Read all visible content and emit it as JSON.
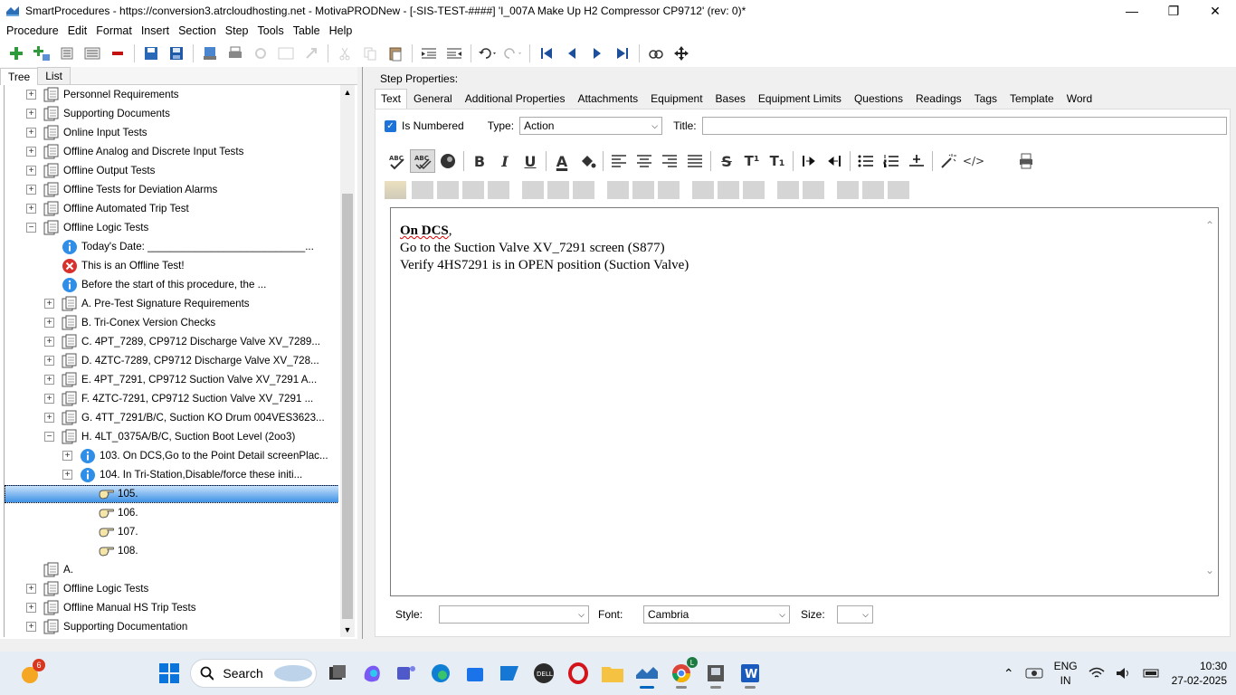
{
  "window": {
    "title": "SmartProcedures - https://conversion3.atrcloudhosting.net - MotivaPRODNew - [-SIS-TEST-####] 'I_007A Make Up H2 Compressor CP9712' (rev: 0)*",
    "controls": [
      "minimize-icon",
      "maximize-icon",
      "close-icon"
    ]
  },
  "menu": [
    "Procedure",
    "Edit",
    "Format",
    "Insert",
    "Section",
    "Step",
    "Tools",
    "Table",
    "Help"
  ],
  "left_tabs": [
    "Tree",
    "List"
  ],
  "tree": [
    {
      "label": "Personnel Requirements",
      "expander": "+",
      "icon": "page-stack-icon"
    },
    {
      "label": "Supporting Documents",
      "expander": "+",
      "icon": "page-stack-icon"
    },
    {
      "label": "Online Input Tests",
      "expander": "+",
      "icon": "page-stack-icon"
    },
    {
      "label": "Offline Analog and Discrete Input Tests",
      "expander": "+",
      "icon": "page-stack-icon"
    },
    {
      "label": "Offline Output Tests",
      "expander": "+",
      "icon": "page-stack-icon"
    },
    {
      "label": "Offline Tests for Deviation Alarms",
      "expander": "+",
      "icon": "page-stack-icon"
    },
    {
      "label": "Offline Automated Trip Test",
      "expander": "+",
      "icon": "page-stack-icon"
    },
    {
      "label": "Offline Logic Tests",
      "expander": "−",
      "icon": "page-stack-icon"
    },
    {
      "label": "Today's Date: ___________________________...",
      "expander": "",
      "icon": "info-icon"
    },
    {
      "label": "This is an Offline Test!",
      "expander": "",
      "icon": "error-icon"
    },
    {
      "label": "Before the start of this procedure, the ...",
      "expander": "",
      "icon": "info-icon"
    },
    {
      "label": "A. Pre-Test Signature Requirements",
      "expander": "+",
      "icon": "page-stack-icon"
    },
    {
      "label": "B. Tri-Conex Version Checks",
      "expander": "+",
      "icon": "page-stack-icon"
    },
    {
      "label": "C. 4PT_7289, CP9712 Discharge Valve XV_7289...",
      "expander": "+",
      "icon": "page-stack-icon"
    },
    {
      "label": "D. 4ZTC-7289, CP9712 Discharge Valve XV_728...",
      "expander": "+",
      "icon": "page-stack-icon"
    },
    {
      "label": "E. 4PT_7291, CP9712 Suction Valve XV_7291 A...",
      "expander": "+",
      "icon": "page-stack-icon"
    },
    {
      "label": "F. 4ZTC-7291, CP9712 Suction Valve XV_7291 ...",
      "expander": "+",
      "icon": "page-stack-icon"
    },
    {
      "label": "G. 4TT_7291/B/C, Suction KO Drum 004VES3623...",
      "expander": "+",
      "icon": "page-stack-icon"
    },
    {
      "label": "H. 4LT_0375A/B/C, Suction Boot Level (2oo3)",
      "expander": "−",
      "icon": "page-stack-icon"
    },
    {
      "label": "103. On DCS,Go to the Point Detail screenPlac...",
      "expander": "+",
      "icon": "info-icon"
    },
    {
      "label": "104. In Tri-Station,Disable/force these initi...",
      "expander": "+",
      "icon": "info-icon"
    },
    {
      "label": "105.",
      "expander": "",
      "icon": "hand-pointer-icon",
      "selected": true
    },
    {
      "label": "106.",
      "expander": "",
      "icon": "hand-pointer-icon"
    },
    {
      "label": "107.",
      "expander": "",
      "icon": "hand-pointer-icon"
    },
    {
      "label": "108.",
      "expander": "",
      "icon": "hand-pointer-icon"
    },
    {
      "label": "A.",
      "expander": "",
      "icon": "page-stack-icon"
    },
    {
      "label": "Offline Logic Tests",
      "expander": "+",
      "icon": "page-stack-icon"
    },
    {
      "label": "Offline Manual HS Trip Tests",
      "expander": "+",
      "icon": "page-stack-icon"
    },
    {
      "label": "Supporting Documentation",
      "expander": "+",
      "icon": "page-stack-icon"
    }
  ],
  "step_properties": {
    "heading": "Step Properties:",
    "tabs": [
      "Text",
      "General",
      "Additional Properties",
      "Attachments",
      "Equipment",
      "Bases",
      "Equipment Limits",
      "Questions",
      "Readings",
      "Tags",
      "Template",
      "Word"
    ],
    "is_numbered_label": "Is Numbered",
    "is_numbered": true,
    "type_label": "Type:",
    "type_value": "Action",
    "title_label": "Title:",
    "title_value": ""
  },
  "format_toolbar": [
    "spellcheck-icon",
    "spellcheck-auto-icon",
    "sphere-icon",
    "bold-icon",
    "italic-icon",
    "underline-icon",
    "font-color-icon",
    "fill-color-icon",
    "align-left-icon",
    "align-center-icon",
    "align-right-icon",
    "justify-icon",
    "strikethrough-icon",
    "superscript-icon",
    "subscript-icon",
    "indent-icon",
    "outdent-icon",
    "bullet-list-icon",
    "numbered-list-icon",
    "horizontal-rule-icon",
    "magic-wand-icon",
    "html-code-icon",
    "print-icon"
  ],
  "format_toolbar_labels": {
    "bold": "B",
    "italic": "I",
    "underline": "U",
    "font_color": "A",
    "strike": "S",
    "sup": "T¹",
    "sub": "T₁",
    "code": "</>"
  },
  "editor": {
    "line1_bold": "On DCS",
    "line1_rest": ",",
    "line2": "Go to the Suction Valve XV_7291 screen (S877)",
    "line3": "Verify 4HS7291 is in OPEN position (Suction Valve)"
  },
  "bottom": {
    "style_label": "Style:",
    "style_value": "",
    "font_label": "Font:",
    "font_value": "Cambria",
    "size_label": "Size:",
    "size_value": ""
  },
  "taskbar": {
    "search_placeholder": "Search",
    "weather_badge": "6",
    "chrome_badge": "L",
    "language": "ENG",
    "region": "IN",
    "time": "10:30",
    "date": "27-02-2025"
  }
}
